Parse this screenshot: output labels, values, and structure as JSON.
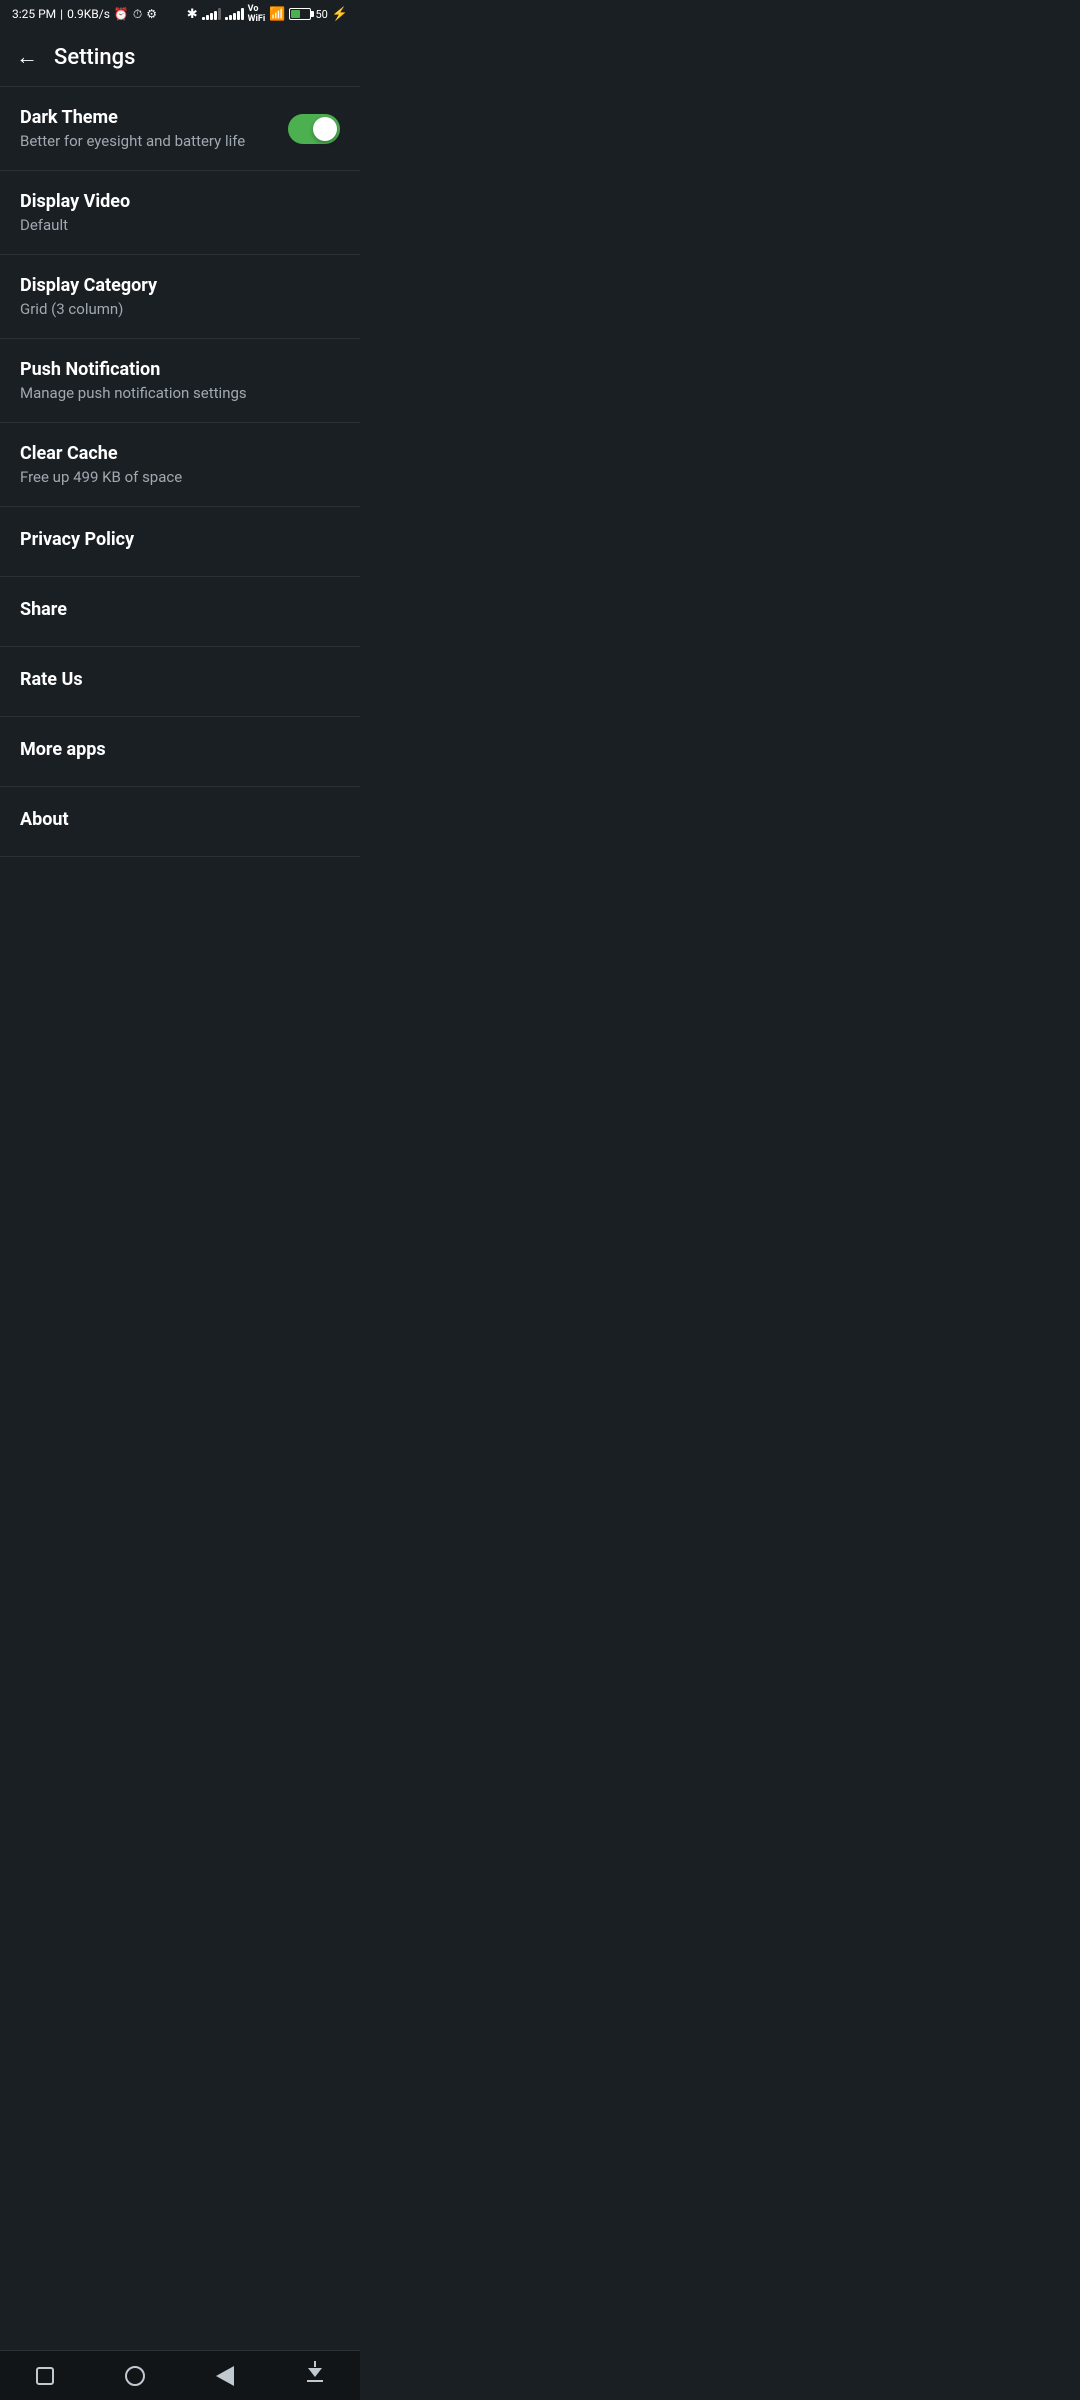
{
  "statusBar": {
    "time": "3:25 PM",
    "network": "0.9KB/s",
    "batteryPercent": "50"
  },
  "header": {
    "backLabel": "←",
    "title": "Settings"
  },
  "settings": {
    "items": [
      {
        "id": "dark-theme",
        "title": "Dark Theme",
        "subtitle": "Better for eyesight and battery life",
        "type": "toggle",
        "toggleOn": true
      },
      {
        "id": "display-video",
        "title": "Display Video",
        "subtitle": "Default",
        "type": "item"
      },
      {
        "id": "display-category",
        "title": "Display Category",
        "subtitle": "Grid (3 column)",
        "type": "item"
      },
      {
        "id": "push-notification",
        "title": "Push Notification",
        "subtitle": "Manage push notification settings",
        "type": "item"
      },
      {
        "id": "clear-cache",
        "title": "Clear Cache",
        "subtitle": "Free up 499 KB of space",
        "type": "item"
      },
      {
        "id": "privacy-policy",
        "title": "Privacy Policy",
        "subtitle": "",
        "type": "simple"
      },
      {
        "id": "share",
        "title": "Share",
        "subtitle": "",
        "type": "simple"
      },
      {
        "id": "rate-us",
        "title": "Rate Us",
        "subtitle": "",
        "type": "simple"
      },
      {
        "id": "more-apps",
        "title": "More apps",
        "subtitle": "",
        "type": "simple"
      },
      {
        "id": "about",
        "title": "About",
        "subtitle": "",
        "type": "simple"
      }
    ]
  },
  "navBar": {
    "buttons": [
      "recent",
      "home",
      "back",
      "menu"
    ]
  }
}
